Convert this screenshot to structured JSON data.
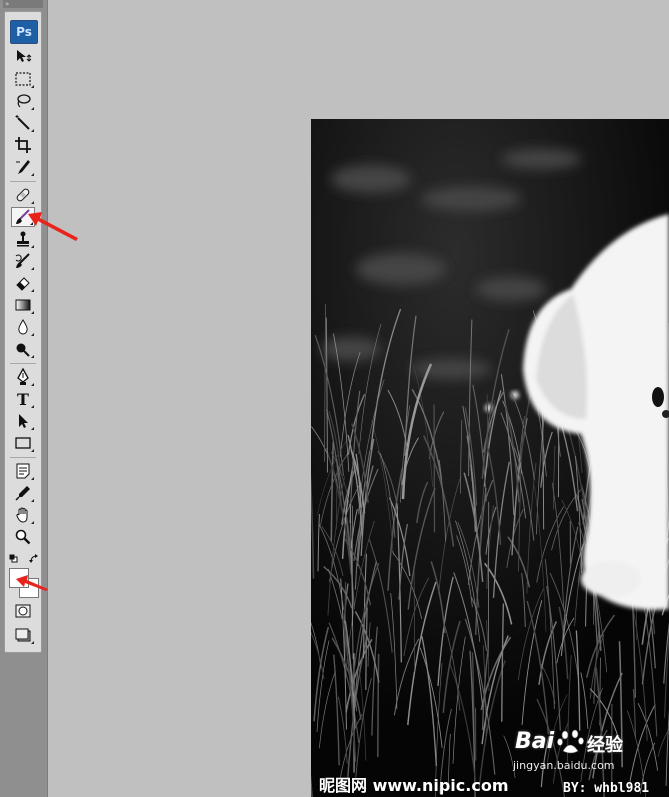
{
  "toolbar": {
    "logo": "Ps",
    "grip": "»",
    "tools": [
      {
        "name": "move-tool",
        "icon": "move-icon",
        "active": false
      },
      {
        "name": "marquee-tool",
        "icon": "rect-marquee-icon",
        "active": false
      },
      {
        "name": "lasso-tool",
        "icon": "lasso-icon",
        "active": false
      },
      {
        "name": "quick-select-tool",
        "icon": "magic-wand-icon",
        "active": false
      },
      {
        "name": "crop-tool",
        "icon": "crop-icon",
        "active": false
      },
      {
        "name": "slice-tool",
        "icon": "slice-icon",
        "active": false
      },
      {
        "name": "healing-tool",
        "icon": "bandage-icon",
        "active": false
      },
      {
        "name": "brush-tool",
        "icon": "brush-icon",
        "active": true
      },
      {
        "name": "stamp-tool",
        "icon": "stamp-icon",
        "active": false
      },
      {
        "name": "history-brush-tool",
        "icon": "history-brush-icon",
        "active": false
      },
      {
        "name": "eraser-tool",
        "icon": "eraser-icon",
        "active": false
      },
      {
        "name": "gradient-tool",
        "icon": "gradient-icon",
        "active": false
      },
      {
        "name": "blur-tool",
        "icon": "drop-icon",
        "active": false
      },
      {
        "name": "dodge-tool",
        "icon": "dodge-icon",
        "active": false
      },
      {
        "name": "pen-tool",
        "icon": "pen-icon",
        "active": false
      },
      {
        "name": "type-tool",
        "icon": "type-icon",
        "active": false
      },
      {
        "name": "path-select-tool",
        "icon": "arrow-cursor-icon",
        "active": false
      },
      {
        "name": "shape-tool",
        "icon": "rectangle-shape-icon",
        "active": false
      },
      {
        "name": "notes-tool",
        "icon": "note-icon",
        "active": false
      },
      {
        "name": "eyedropper-tool",
        "icon": "eyedropper-icon",
        "active": false
      },
      {
        "name": "hand-tool",
        "icon": "hand-icon",
        "active": false
      },
      {
        "name": "zoom-tool",
        "icon": "magnifier-icon",
        "active": false
      },
      {
        "name": "quick-mask-button",
        "icon": "quick-mask-icon",
        "active": false
      },
      {
        "name": "screen-mode-button",
        "icon": "screen-mode-icon",
        "active": false
      }
    ],
    "foreground_color": "#ffffff",
    "background_color": "#ffffff"
  },
  "canvas": {
    "watermark_left": "昵图网 www.nipic.com",
    "watermark_right": "BY: whbl981"
  },
  "baidu_watermark": {
    "logo": "Bai",
    "jingyan": "经验",
    "url": "jingyan.baidu.com"
  },
  "colors": {
    "arrow": "#e8231b",
    "workspace": "#c0c0c0",
    "ps_blue": "#1f5fa6"
  }
}
